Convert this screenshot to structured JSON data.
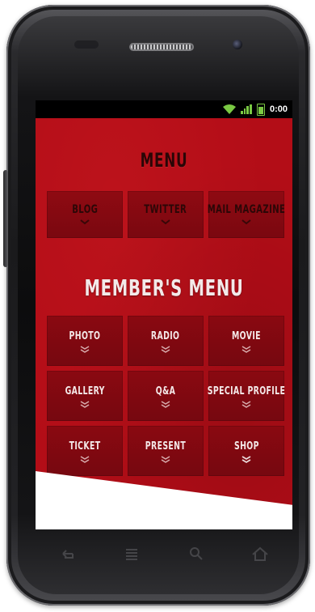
{
  "status_bar": {
    "time": "0:00",
    "icons": [
      "wifi-icon",
      "signal-icon",
      "battery-icon"
    ],
    "accent_color": "#7ac943"
  },
  "menu": {
    "title": "MENU",
    "items": [
      {
        "label": "BLOG"
      },
      {
        "label": "TWITTER"
      },
      {
        "label": "MAIL MAGAZINE"
      }
    ]
  },
  "members_menu": {
    "title": "MEMBER'S MENU",
    "items": [
      {
        "label": "PHOTO"
      },
      {
        "label": "RADIO"
      },
      {
        "label": "MOVIE"
      },
      {
        "label": "GALLERY"
      },
      {
        "label": "Q&A"
      },
      {
        "label": "SPECIAL PROFILE"
      },
      {
        "label": "TICKET"
      },
      {
        "label": "PRESENT"
      },
      {
        "label": "SHOP"
      }
    ]
  },
  "nav_icons": [
    "back-icon",
    "menu-icon",
    "search-icon",
    "home-icon"
  ],
  "colors": {
    "background_red": "#b30d17",
    "tile_red": "#8a0911",
    "label_light": "#f4e8e8"
  }
}
